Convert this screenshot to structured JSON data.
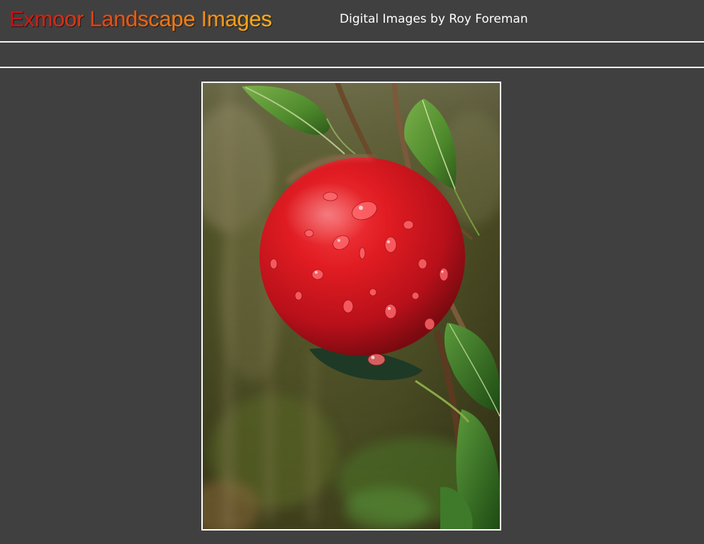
{
  "header": {
    "site_title": "Exmoor Landscape Images",
    "subtitle": "Digital Images by Roy Foreman"
  },
  "colors": {
    "background": "#404040",
    "rule": "#f2f2f2",
    "title_gradient_start": "#c0121a",
    "title_gradient_end": "#f2b41e",
    "subtitle": "#ffffff"
  },
  "photo": {
    "icon": "photo-red-apple-on-branch"
  }
}
